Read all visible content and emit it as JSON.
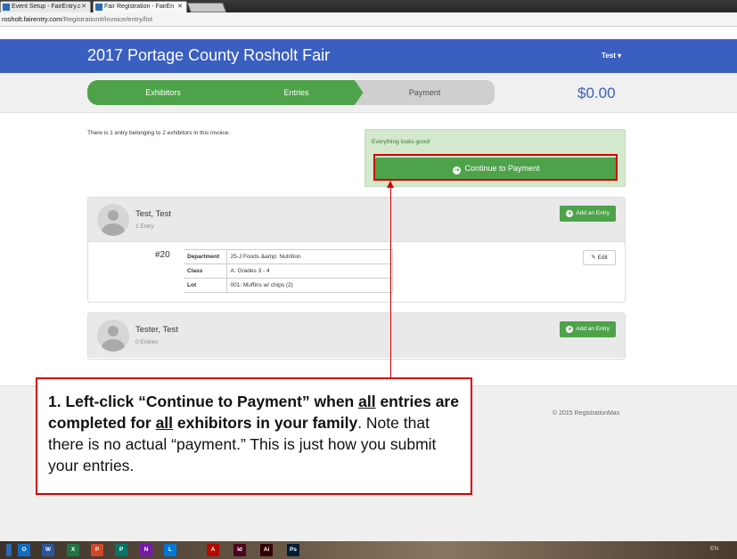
{
  "browser": {
    "tabs": [
      {
        "label": "Event Setup - FairEntry.c"
      },
      {
        "label": "Fair Registration - FairEn"
      }
    ],
    "url_prefix": "rosholt.fairentry.com",
    "url_path": "/Registration#/invoice/entry/list"
  },
  "navbar": {
    "title": "2017 Portage County Rosholt Fair",
    "user": "Test ▾"
  },
  "wizard": {
    "steps": [
      "Exhibitors",
      "Entries",
      "Payment"
    ],
    "total": "$0.00"
  },
  "main": {
    "summary": "There is 1 entry belonging to 2 exhibitors in this invoice.",
    "alert": "Everything looks good!",
    "continue_label": "Continue to Payment",
    "exhibitors": [
      {
        "name": "Test, Test",
        "count": "1 Entry",
        "add_label": "Add an Entry",
        "entries": [
          {
            "number": "#20",
            "edit_label": "Edit",
            "fields": [
              {
                "key": "Department",
                "value": "25-J Foods &amp; Nutrition"
              },
              {
                "key": "Class",
                "value": "A: Grades 3 - 4"
              },
              {
                "key": "Lot",
                "value": "001: Muffins w/ chips (2)"
              }
            ]
          }
        ]
      },
      {
        "name": "Tester, Test",
        "count": "0 Entries",
        "add_label": "Add an Entry"
      }
    ]
  },
  "footer": {
    "copyright": "© 2015 RegistrationMax"
  },
  "callout": {
    "part1": "1. Left-click “Continue to Payment” when ",
    "u1": "all",
    "part2": " entries are completed for ",
    "u2": "all",
    "part3": " exhibitors in your family",
    "part4": ". Note that there is no actual “payment.” This is just how you submit your entries."
  },
  "taskbar": {
    "icons": [
      {
        "name": "outlook",
        "glyph": "O",
        "color": "#0f6cc4"
      },
      {
        "name": "word",
        "glyph": "W",
        "color": "#2b579a"
      },
      {
        "name": "excel",
        "glyph": "X",
        "color": "#217346"
      },
      {
        "name": "powerpoint",
        "glyph": "P",
        "color": "#d24726"
      },
      {
        "name": "publisher",
        "glyph": "P",
        "color": "#077568"
      },
      {
        "name": "onenote",
        "glyph": "N",
        "color": "#7719aa"
      },
      {
        "name": "lync",
        "glyph": "L",
        "color": "#0078d7"
      },
      {
        "name": "acrobat",
        "glyph": "A",
        "color": "#b30b00"
      },
      {
        "name": "indesign",
        "glyph": "Id",
        "color": "#49021f"
      },
      {
        "name": "illustrator",
        "glyph": "Ai",
        "color": "#330000"
      },
      {
        "name": "photoshop",
        "glyph": "Ps",
        "color": "#001e36"
      }
    ],
    "lang": "EN"
  }
}
